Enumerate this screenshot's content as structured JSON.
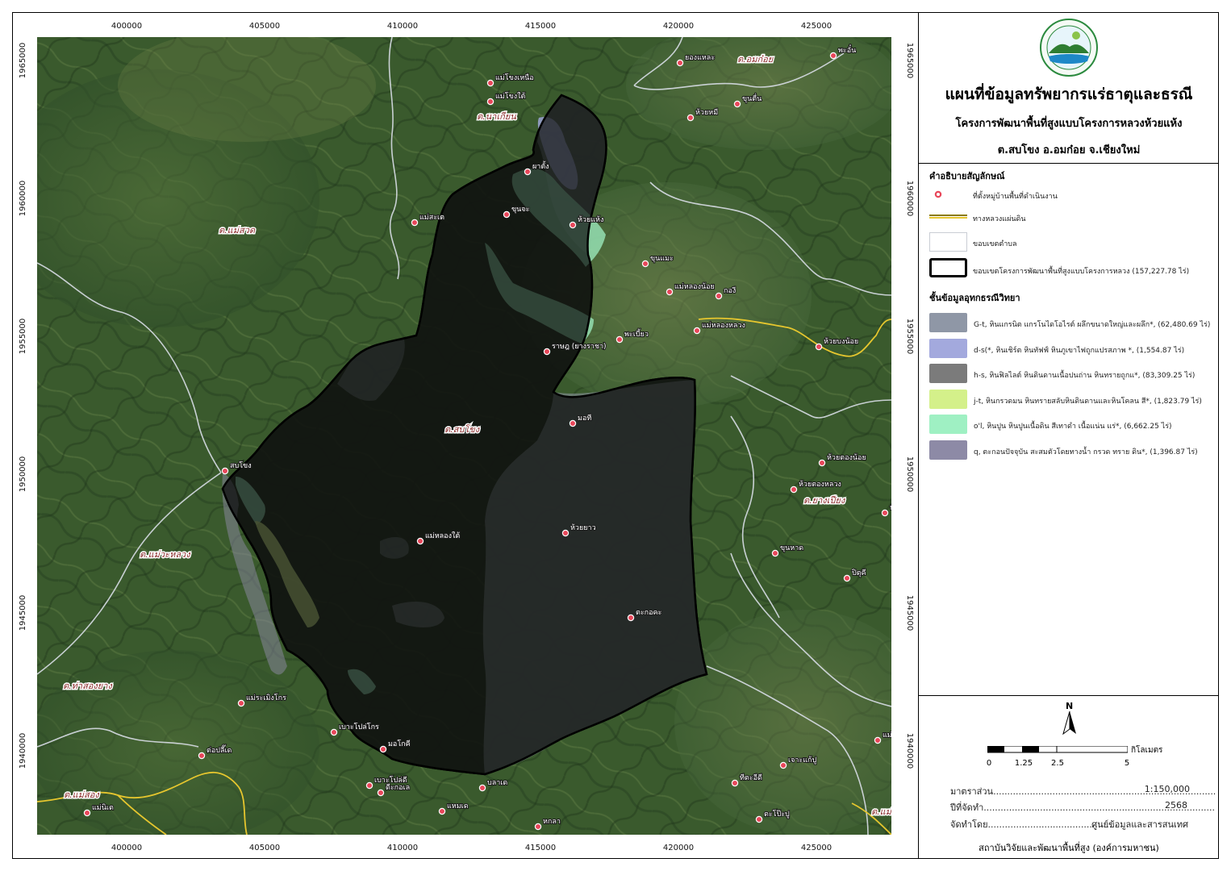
{
  "map": {
    "coords_top": [
      "400000",
      "405000",
      "410000",
      "415000",
      "420000",
      "425000"
    ],
    "coords_bottom": [
      "400000",
      "405000",
      "410000",
      "415000",
      "420000",
      "425000"
    ],
    "coords_left": [
      "1965000",
      "1960000",
      "1955000",
      "1950000",
      "1945000",
      "1940000"
    ],
    "coords_right": [
      "1965000",
      "1960000",
      "1955000",
      "1950000",
      "1945000",
      "1940000"
    ],
    "subdistricts": [
      "ต.นาเกียน",
      "ต.อมก๋อย",
      "ต.แม่สวด",
      "ต.สบโขง",
      "ต.ยางเปียง",
      "ต.แม่วะหลวง",
      "ต.ท่าสองยาง",
      "ต.แม่สอง",
      "ต.แม่ตื่น"
    ],
    "villages": [
      "แม่โขงเหนือ",
      "แม่โขงใต้",
      "ยองแหละ",
      "พะอั๋น",
      "ห้วยหมี",
      "ขุนตื่น",
      "ผาตั้ง",
      "แม่สะเต",
      "ขุนจะ",
      "ห้วยแห้ง",
      "ขุนแมะ",
      "แม่หลองน้อย",
      "กองี",
      "แม่หลองหลวง",
      "พะเบี้ยว",
      "ห้วยบงน้อย",
      "ราษฎ (ยางราชา)",
      "มอที",
      "สบโขง",
      "ห้วยตองน้อย",
      "ห้วยตองหลวง",
      "ห้วยโค้ง",
      "แม่หลองใต้",
      "ห้วยยาว",
      "ขุนหาด",
      "ปิตุคี",
      "ตะกอคะ",
      "แม่ระเมิงโกร",
      "เบาะโปล่โกร",
      "มอโกคี",
      "ต่อปลี๊เด",
      "แม่นิเต",
      "เบาะโปล่ดี",
      "ดีะกอเล",
      "แหมเด",
      "บลาเด",
      "ทีตะอีดี",
      "เจาะแก้ปู",
      "ตะโป๊ะปู",
      "แม่ระอาโน",
      "หกลา"
    ]
  },
  "legend": {
    "heading": "คำอธิบายสัญลักษณ์",
    "village_label": "ที่ตั้งหมู่บ้านพื้นที่ดำเนินงาน",
    "road_label": "ทางหลวงแผ่นดิน",
    "subdistrict_label": "ขอบเขตตำบล",
    "project_label": "ขอบเขตโครงการพัฒนาพื้นที่สูงแบบโครงการหลวง (157,227.78 ไร่)",
    "geo_heading": "ชั้นข้อมูลอุทกธรณีวิทยา",
    "geo_items": [
      {
        "label": "G-t,  หินแกรนิต แกรโนไดโอไรต์ ผลึกขนาดใหญ่และผลึก*, (62,480.69 ไร่)",
        "color": "#8f97a6"
      },
      {
        "label": "d-s(*,  หินเชิร์ต หินทัฟฟ์ หินภูเขาไฟถูกแปรสภาพ *, (1,554.87 ไร่)",
        "color": "#a3a9dd"
      },
      {
        "label": "h-s,  หินฟิลไลต์ หินดินดานเนื้อปนถ่าน หินทรายถูกแ*, (83,309.25 ไร่)",
        "color": "#7b7b7b"
      },
      {
        "label": "j-t,  หินกรวดมน หินทรายสลับหินดินดานและหินโคลน สี*, (1,823.79 ไร่)",
        "color": "#d4f08a"
      },
      {
        "label": "o'l,  หินปูน หินปูนเนื้อดิน สีเทาดำ เนื้อแน่น แร่*, (6,662.25 ไร่)",
        "color": "#9ff0c3"
      },
      {
        "label": "q,  ตะกอนปัจจุบัน สะสมตัวโดยทางน้ำ กรวด  ทราย ดิน*, (1,396.87 ไร่)",
        "color": "#8d8aa6"
      }
    ]
  },
  "title": {
    "main": "แผนที่ข้อมูลทรัพยากรแร่ธาตุและธรณี",
    "sub1": "โครงการพัฒนาพื้นที่สูงแบบโครงการหลวงห้วยแห้ง",
    "sub2": "ต.สบโขง อ.อมก๋อย จ.เชียงใหม่"
  },
  "scalebar": {
    "north": "N",
    "labels": [
      "0",
      "1.25",
      "2.5",
      "5"
    ],
    "unit": "กิโลเมตร",
    "segments": 4
  },
  "info": {
    "scale_label": "มาตราส่วน",
    "scale_value": "1:150,000",
    "year_label": "ปีที่จัดทำ",
    "year_value": "2568",
    "by_label": "จัดทำโดย",
    "by_value": "ศูนย์ข้อมูลและสารสนเทศ",
    "org": "สถาบันวิจัยและพัฒนาพื้นที่สูง (องค์การมหาชน)"
  },
  "colors": {
    "terrain": "#3b5a2c",
    "road": "#e6c62e",
    "boundary": "#d8dde6",
    "project": "#000000"
  }
}
